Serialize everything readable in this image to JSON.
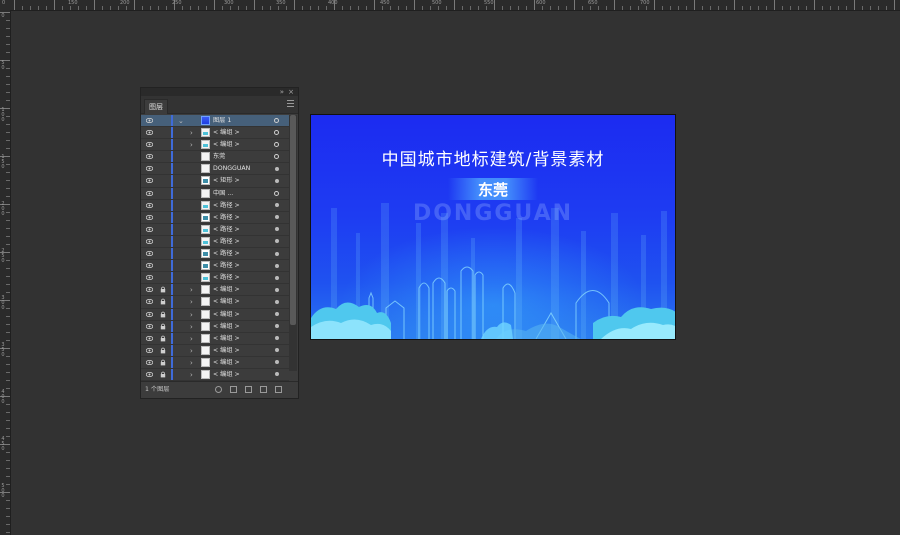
{
  "rulers": {
    "top_labels": [
      "0",
      "150",
      "200",
      "250",
      "300",
      "350",
      "400",
      "450",
      "500",
      "550",
      "600",
      "650",
      "700"
    ],
    "left_labels": [
      "0",
      "50",
      "100",
      "150",
      "200",
      "250",
      "300",
      "350",
      "400",
      "450",
      "500"
    ]
  },
  "layers_panel": {
    "tab_label": "图层",
    "collapse_icon": "double-arrow-icon",
    "close_label": "×",
    "footer_count": "1 个图层",
    "rows": [
      {
        "name": "图层 1",
        "eye": true,
        "lock": false,
        "expand": "open",
        "thumb": "t-blue",
        "target": "ring",
        "selected": true
      },
      {
        "name": "< 编组 >",
        "eye": true,
        "lock": false,
        "expand": "closed",
        "thumb": "t-sky",
        "target": "ring"
      },
      {
        "name": "< 编组 >",
        "eye": true,
        "lock": false,
        "expand": "closed",
        "thumb": "t-sky",
        "target": "ring"
      },
      {
        "name": "东莞",
        "eye": true,
        "lock": false,
        "expand": "none",
        "thumb": "",
        "target": "ring"
      },
      {
        "name": "DONGGUAN",
        "eye": true,
        "lock": false,
        "expand": "none",
        "thumb": "",
        "target": "filled"
      },
      {
        "name": "< 矩形 >",
        "eye": true,
        "lock": false,
        "expand": "none",
        "thumb": "t-shape",
        "target": "filled"
      },
      {
        "name": "中国 ...",
        "eye": true,
        "lock": false,
        "expand": "none",
        "thumb": "",
        "target": "ring"
      },
      {
        "name": "< 路径 >",
        "eye": true,
        "lock": false,
        "expand": "none",
        "thumb": "t-sky",
        "target": "filled"
      },
      {
        "name": "< 路径 >",
        "eye": true,
        "lock": false,
        "expand": "none",
        "thumb": "t-shape",
        "target": "filled"
      },
      {
        "name": "< 路径 >",
        "eye": true,
        "lock": false,
        "expand": "none",
        "thumb": "t-sky",
        "target": "filled"
      },
      {
        "name": "< 路径 >",
        "eye": true,
        "lock": false,
        "expand": "none",
        "thumb": "t-sky",
        "target": "filled"
      },
      {
        "name": "< 路径 >",
        "eye": true,
        "lock": false,
        "expand": "none",
        "thumb": "t-shape",
        "target": "filled"
      },
      {
        "name": "< 路径 >",
        "eye": true,
        "lock": false,
        "expand": "none",
        "thumb": "t-shape",
        "target": "filled"
      },
      {
        "name": "< 路径 >",
        "eye": true,
        "lock": false,
        "expand": "none",
        "thumb": "t-sky",
        "target": "filled"
      },
      {
        "name": "< 编组 >",
        "eye": true,
        "lock": true,
        "expand": "closed",
        "thumb": "",
        "target": "filled"
      },
      {
        "name": "< 编组 >",
        "eye": true,
        "lock": true,
        "expand": "closed",
        "thumb": "",
        "target": "filled"
      },
      {
        "name": "< 编组 >",
        "eye": true,
        "lock": true,
        "expand": "closed",
        "thumb": "",
        "target": "filled"
      },
      {
        "name": "< 编组 >",
        "eye": true,
        "lock": true,
        "expand": "closed",
        "thumb": "",
        "target": "filled"
      },
      {
        "name": "< 编组 >",
        "eye": true,
        "lock": true,
        "expand": "closed",
        "thumb": "",
        "target": "filled"
      },
      {
        "name": "< 编组 >",
        "eye": true,
        "lock": true,
        "expand": "closed",
        "thumb": "",
        "target": "filled"
      },
      {
        "name": "< 编组 >",
        "eye": true,
        "lock": true,
        "expand": "closed",
        "thumb": "",
        "target": "filled"
      },
      {
        "name": "< 编组 >",
        "eye": true,
        "lock": true,
        "expand": "closed",
        "thumb": "",
        "target": "filled"
      },
      {
        "name": "< 编组 >",
        "eye": true,
        "lock": true,
        "expand": "closed",
        "thumb": "",
        "target": "filled"
      }
    ]
  },
  "artboard": {
    "title": "中国城市地标建筑/背景素材",
    "city": "东莞",
    "city_en": "DONGGUAN"
  },
  "colors": {
    "workspace": "#323232",
    "panel": "#3c3c3c",
    "selection": "#46607a",
    "layer_color": "#3f6bd9",
    "art_blue": "#1f3cf2",
    "art_cyan": "#4dc8f0"
  }
}
